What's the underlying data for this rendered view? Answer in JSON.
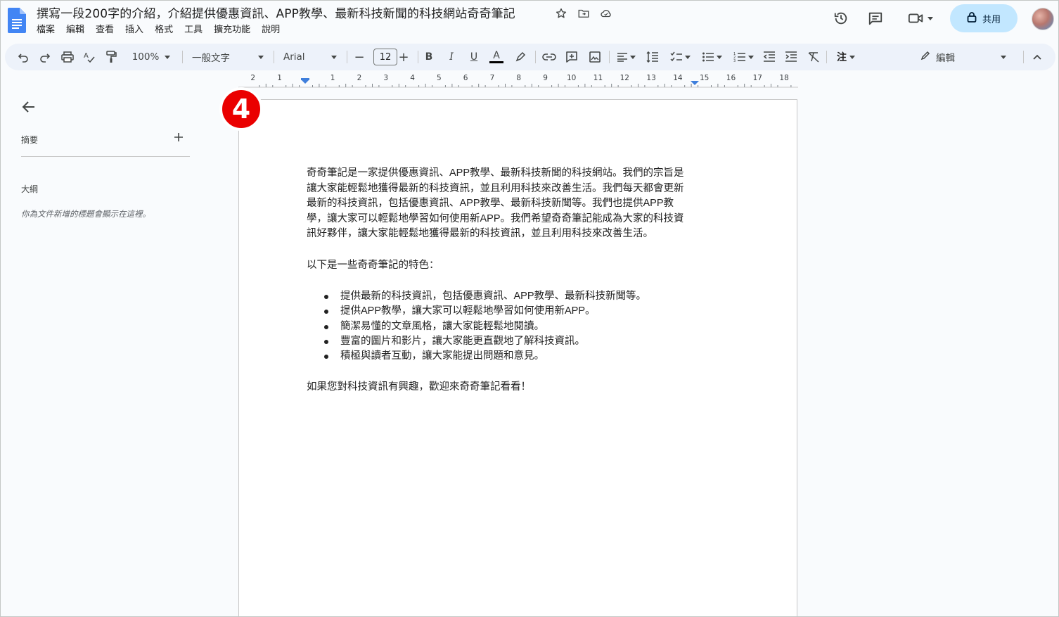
{
  "document": {
    "title": "撰寫一段200字的介紹，介紹提供優惠資訊、APP教學、最新科技新聞的科技網站奇奇筆記"
  },
  "menubar": [
    "檔案",
    "編輯",
    "查看",
    "插入",
    "格式",
    "工具",
    "擴充功能",
    "說明"
  ],
  "share_button": {
    "label": "共用"
  },
  "toolbar": {
    "zoom": "100%",
    "style": "一般文字",
    "font": "Arial",
    "font_size": "12",
    "mode": "編輯"
  },
  "ruler": {
    "labels": [
      "2",
      "1",
      "1",
      "2",
      "3",
      "4",
      "5",
      "6",
      "7",
      "8",
      "9",
      "10",
      "11",
      "12",
      "13",
      "14",
      "15",
      "16",
      "17",
      "18"
    ]
  },
  "left_panel": {
    "summary_label": "摘要",
    "outline_label": "大綱",
    "outline_hint": "你為文件新增的標題會顯示在這裡。"
  },
  "step_marker": "4",
  "content": {
    "intro": "奇奇筆記是一家提供優惠資訊、APP教學、最新科技新聞的科技網站。我們的宗旨是讓大家能輕鬆地獲得最新的科技資訊，並且利用科技來改善生活。我們每天都會更新最新的科技資訊，包括優惠資訊、APP教學、最新科技新聞等。我們也提供APP教學，讓大家可以輕鬆地學習如何使用新APP。我們希望奇奇筆記能成為大家的科技資訊好夥伴，讓大家能輕鬆地獲得最新的科技資訊，並且利用科技來改善生活。",
    "features_heading": "以下是一些奇奇筆記的特色：",
    "features": [
      "提供最新的科技資訊，包括優惠資訊、APP教學、最新科技新聞等。",
      "提供APP教學，讓大家可以輕鬆地學習如何使用新APP。",
      "簡潔易懂的文章風格，讓大家能輕鬆地閱讀。",
      "豐富的圖片和影片，讓大家能更直觀地了解科技資訊。",
      "積極與讀者互動，讓大家能提出問題和意見。"
    ],
    "closing": "如果您對科技資訊有興趣，歡迎來奇奇筆記看看！"
  },
  "icons": {
    "title_bar": [
      "star-icon",
      "move-to-folder-icon",
      "cloud-saved-icon"
    ],
    "right_actions": [
      "version-history-icon",
      "comments-icon",
      "meet-icon",
      "lock-icon"
    ],
    "toolbar": [
      "undo-icon",
      "redo-icon",
      "print-icon",
      "spellcheck-icon",
      "paint-format-icon",
      "bold-icon",
      "italic-icon",
      "underline-icon",
      "text-color-icon",
      "highlight-icon",
      "link-icon",
      "add-comment-icon",
      "insert-image-icon",
      "align-icon",
      "line-spacing-icon",
      "checklist-icon",
      "bullet-list-icon",
      "numbered-list-icon",
      "decrease-indent-icon",
      "increase-indent-icon",
      "clear-formatting-icon",
      "pencil-icon",
      "collapse-icon"
    ]
  },
  "colors": {
    "share_button_bg": "#c2e7ff",
    "toolbar_bg": "#edf2fa",
    "doc_blue": "#4285f4",
    "step_marker_red": "#ea0000"
  }
}
